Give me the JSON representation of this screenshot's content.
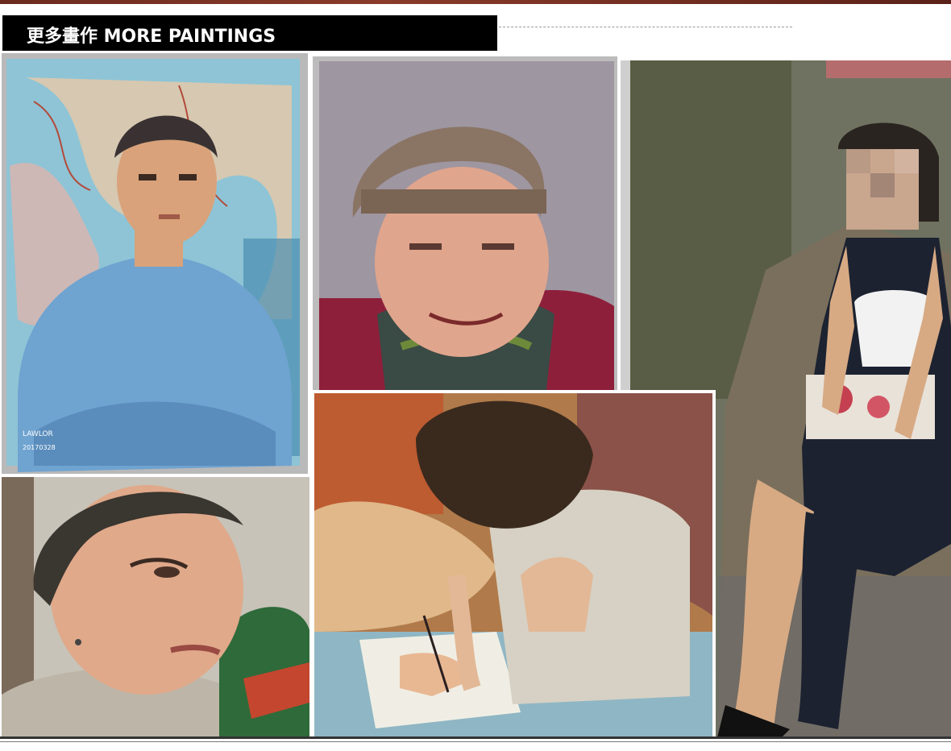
{
  "header": {
    "title": "更多畫作 MORE PAINTINGS"
  },
  "paintings": [
    {
      "subject": "man in blue shirt, arms crossed, map background",
      "signature": "LAWLOR",
      "date_mark": "20170328"
    },
    {
      "subject": "elderly woman in knit hat and scarf"
    },
    {
      "subject": "seated woman in black dress with handbag (face blurred)"
    },
    {
      "subject": "short-haired person with earring looking sideways"
    },
    {
      "subject": "girl writing with a pen"
    }
  ],
  "colors": {
    "title_bar": "#000000",
    "title_text": "#ffffff",
    "frame_gray": "#b9b9b9"
  }
}
